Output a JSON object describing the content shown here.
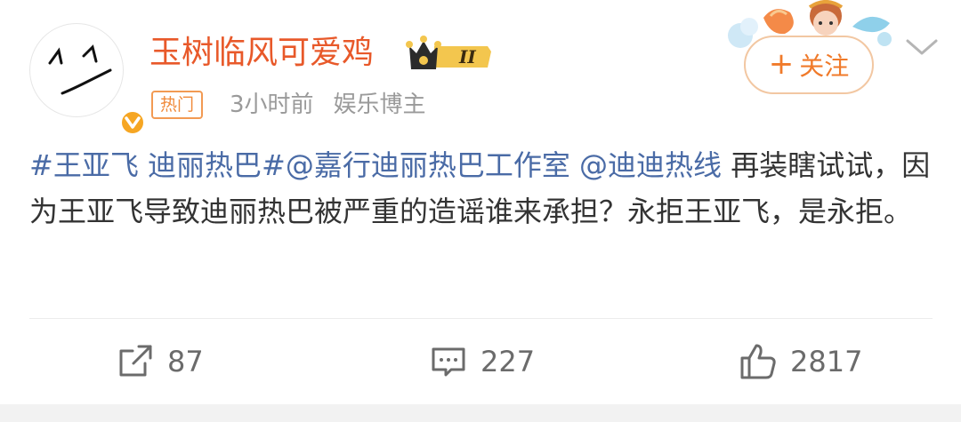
{
  "post": {
    "username": "玉树临风可爱鸡",
    "level_badge": "II",
    "hot_tag": "热门",
    "time": "3小时前",
    "category": "娱乐博主",
    "follow_label": "关注",
    "content": {
      "tag1": "#王亚飞 迪丽热巴#",
      "mention1": "@嘉行迪丽热巴工作室",
      "mention2": "@迪迪热线",
      "text": " 再装瞎试试，因为王亚飞导致迪丽热巴被严重的造谣谁来承担？永拒王亚飞，是永拒。"
    },
    "actions": {
      "repost_count": "87",
      "comment_count": "227",
      "like_count": "2817"
    }
  },
  "colors": {
    "username": "#e8592a",
    "link": "#4a6ba6",
    "hot_tag": "#f08a3a",
    "meta": "#9a9a9a"
  },
  "icons": {
    "avatar": "smiley-face",
    "verified": "verified-v-icon",
    "repost": "share-icon",
    "comment": "comment-icon",
    "like": "thumbs-up-icon",
    "more": "chevron-down-icon"
  }
}
